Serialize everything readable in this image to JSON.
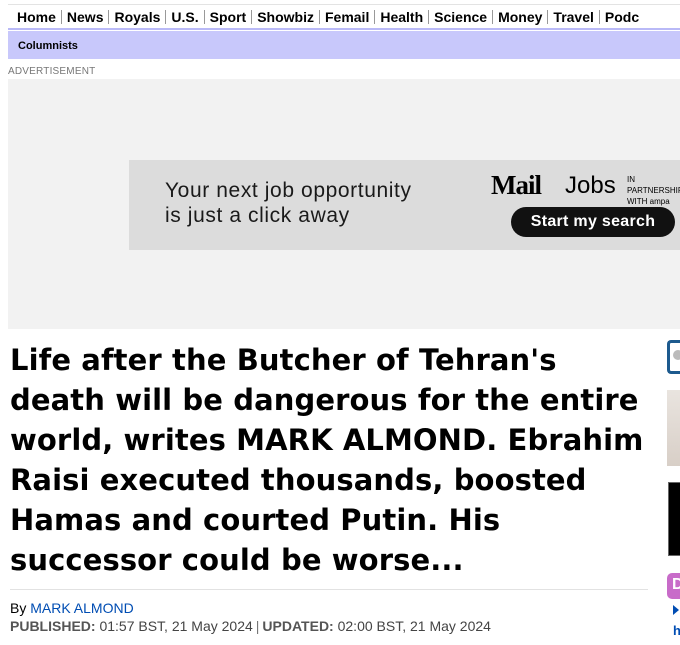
{
  "nav": {
    "items": [
      "Home",
      "News",
      "Royals",
      "U.S.",
      "Sport",
      "Showbiz",
      "Femail",
      "Health",
      "Science",
      "Money",
      "Travel",
      "Podc"
    ]
  },
  "subnav": {
    "items": [
      "Columnists"
    ]
  },
  "ad": {
    "label": "ADVERTISEMENT",
    "banner_line1": "Your next job opportunity",
    "banner_line2": "is just a click away",
    "brand_logo": "Mail",
    "brand_jobs": "Jobs",
    "partner_line1": "IN PARTNERSHIP",
    "partner_line2": "WITH ampa",
    "cta_label": "Start my search"
  },
  "article": {
    "headline": "Life after the Butcher of Tehran's death will be dangerous for the entire world, writes MARK ALMOND. Ebrahim Raisi executed thousands, boosted Hamas and courted Putin. His successor could be worse...",
    "byline_prefix": "By",
    "author": "MARK ALMOND",
    "published_label": "PUBLISHED:",
    "published_value": "01:57 BST, 21 May 2024",
    "updated_label": "UPDATED:",
    "updated_value": "02:00 BST, 21 May 2024"
  },
  "sidebar": {
    "partial_letter": "D",
    "partial_link": "h"
  },
  "colors": {
    "accent": "#c8c8fb",
    "link": "#004db3",
    "cta_bg": "#111111"
  }
}
